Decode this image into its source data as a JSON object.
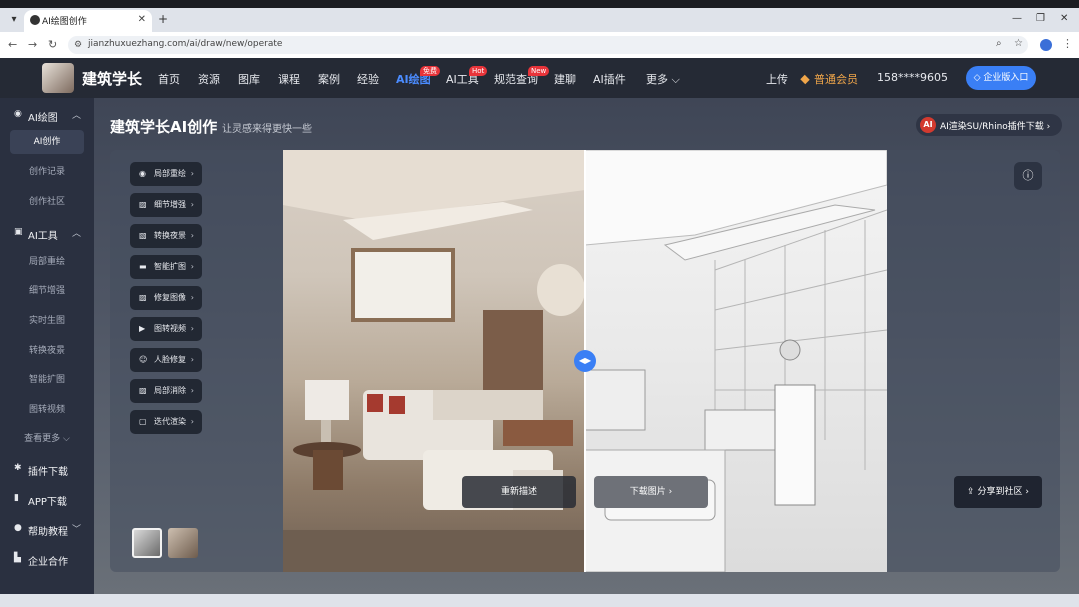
{
  "browser": {
    "tab_title": "AI绘图创作",
    "url": "jianzhuxuezhang.com/ai/draw/new/operate"
  },
  "header": {
    "logo_text": "建筑学长",
    "nav": [
      {
        "label": "首页"
      },
      {
        "label": "资源"
      },
      {
        "label": "图库"
      },
      {
        "label": "课程"
      },
      {
        "label": "案例"
      },
      {
        "label": "经验"
      },
      {
        "label": "AI绘图",
        "badge": "免费"
      },
      {
        "label": "AI工具",
        "badge": "Hot"
      },
      {
        "label": "规范查询",
        "badge": "New"
      },
      {
        "label": "建聊"
      },
      {
        "label": "AI插件"
      },
      {
        "label": "更多"
      }
    ],
    "upload": "上传",
    "member": "普通会员",
    "phone": "158****9605",
    "enterprise_button": "企业版入口"
  },
  "sidebar": {
    "section_ai_draw": "AI绘图",
    "ai_draw_items": [
      "AI创作",
      "创作记录",
      "创作社区"
    ],
    "section_ai_tools": "AI工具",
    "ai_tools_items": [
      "局部重绘",
      "细节增强",
      "实时生图",
      "转换夜景",
      "智能扩图",
      "图转视频",
      "查看更多"
    ],
    "plugin_download": "插件下载",
    "app_download": "APP下载",
    "help": "帮助教程",
    "enterprise": "企业合作"
  },
  "main": {
    "title": "建筑学长AI创作",
    "subtitle": "让灵感来得更快一些",
    "plugin_button": "AI渲染SU/Rhino插件下载",
    "tools": [
      "局部重绘",
      "细节增强",
      "转换夜景",
      "智能扩图",
      "修复图像",
      "图转视频",
      "人脸修复",
      "局部消除",
      "迭代渲染"
    ],
    "regenerate": "重新描述",
    "download": "下载图片",
    "share": "分享到社区"
  },
  "colors": {
    "accent": "#3a7ff5",
    "badge": "#e8343a",
    "member": "#f0a64a"
  }
}
